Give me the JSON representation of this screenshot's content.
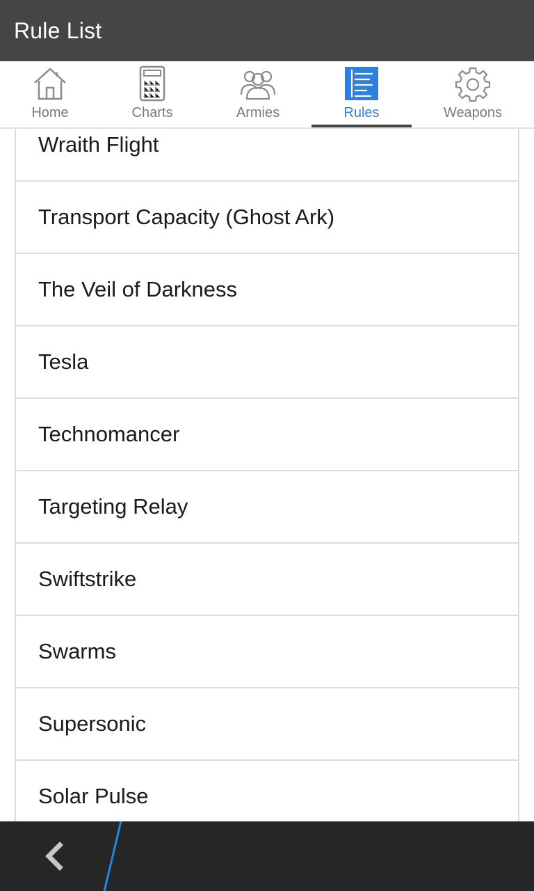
{
  "app": {
    "title": "Rule List"
  },
  "tabs": [
    {
      "label": "Home",
      "icon": "home-icon"
    },
    {
      "label": "Charts",
      "icon": "calculator-icon"
    },
    {
      "label": "Armies",
      "icon": "group-icon"
    },
    {
      "label": "Rules",
      "icon": "list-icon",
      "active": true
    },
    {
      "label": "Weapons",
      "icon": "gear-icon"
    }
  ],
  "rules": [
    "Wraith Flight",
    "Transport Capacity (Ghost Ark)",
    "The Veil of Darkness",
    "Tesla",
    "Technomancer",
    "Targeting Relay",
    "Swiftstrike",
    "Swarms",
    "Supersonic",
    "Solar Pulse"
  ],
  "navigation": {
    "back_icon": "chevron-left-icon"
  },
  "colors": {
    "header": "#454545",
    "accent": "#2f7fe0",
    "bottom_bar": "#262626",
    "separator": "#1e88e5"
  }
}
